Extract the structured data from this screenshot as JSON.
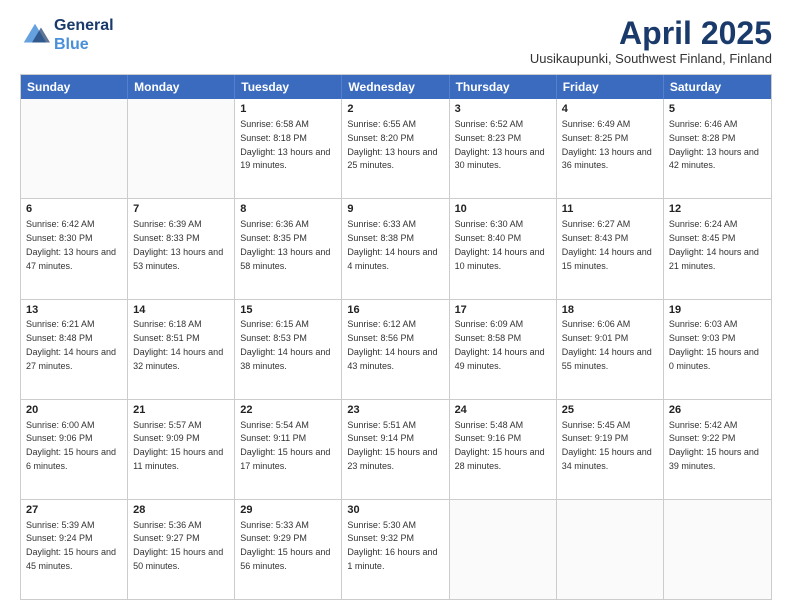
{
  "header": {
    "logo_line1": "General",
    "logo_line2": "Blue",
    "month_title": "April 2025",
    "location": "Uusikaupunki, Southwest Finland, Finland"
  },
  "days_of_week": [
    "Sunday",
    "Monday",
    "Tuesday",
    "Wednesday",
    "Thursday",
    "Friday",
    "Saturday"
  ],
  "weeks": [
    [
      {
        "day": "",
        "empty": true
      },
      {
        "day": "",
        "empty": true
      },
      {
        "day": "1",
        "sunrise": "Sunrise: 6:58 AM",
        "sunset": "Sunset: 8:18 PM",
        "daylight": "Daylight: 13 hours and 19 minutes."
      },
      {
        "day": "2",
        "sunrise": "Sunrise: 6:55 AM",
        "sunset": "Sunset: 8:20 PM",
        "daylight": "Daylight: 13 hours and 25 minutes."
      },
      {
        "day": "3",
        "sunrise": "Sunrise: 6:52 AM",
        "sunset": "Sunset: 8:23 PM",
        "daylight": "Daylight: 13 hours and 30 minutes."
      },
      {
        "day": "4",
        "sunrise": "Sunrise: 6:49 AM",
        "sunset": "Sunset: 8:25 PM",
        "daylight": "Daylight: 13 hours and 36 minutes."
      },
      {
        "day": "5",
        "sunrise": "Sunrise: 6:46 AM",
        "sunset": "Sunset: 8:28 PM",
        "daylight": "Daylight: 13 hours and 42 minutes."
      }
    ],
    [
      {
        "day": "6",
        "sunrise": "Sunrise: 6:42 AM",
        "sunset": "Sunset: 8:30 PM",
        "daylight": "Daylight: 13 hours and 47 minutes."
      },
      {
        "day": "7",
        "sunrise": "Sunrise: 6:39 AM",
        "sunset": "Sunset: 8:33 PM",
        "daylight": "Daylight: 13 hours and 53 minutes."
      },
      {
        "day": "8",
        "sunrise": "Sunrise: 6:36 AM",
        "sunset": "Sunset: 8:35 PM",
        "daylight": "Daylight: 13 hours and 58 minutes."
      },
      {
        "day": "9",
        "sunrise": "Sunrise: 6:33 AM",
        "sunset": "Sunset: 8:38 PM",
        "daylight": "Daylight: 14 hours and 4 minutes."
      },
      {
        "day": "10",
        "sunrise": "Sunrise: 6:30 AM",
        "sunset": "Sunset: 8:40 PM",
        "daylight": "Daylight: 14 hours and 10 minutes."
      },
      {
        "day": "11",
        "sunrise": "Sunrise: 6:27 AM",
        "sunset": "Sunset: 8:43 PM",
        "daylight": "Daylight: 14 hours and 15 minutes."
      },
      {
        "day": "12",
        "sunrise": "Sunrise: 6:24 AM",
        "sunset": "Sunset: 8:45 PM",
        "daylight": "Daylight: 14 hours and 21 minutes."
      }
    ],
    [
      {
        "day": "13",
        "sunrise": "Sunrise: 6:21 AM",
        "sunset": "Sunset: 8:48 PM",
        "daylight": "Daylight: 14 hours and 27 minutes."
      },
      {
        "day": "14",
        "sunrise": "Sunrise: 6:18 AM",
        "sunset": "Sunset: 8:51 PM",
        "daylight": "Daylight: 14 hours and 32 minutes."
      },
      {
        "day": "15",
        "sunrise": "Sunrise: 6:15 AM",
        "sunset": "Sunset: 8:53 PM",
        "daylight": "Daylight: 14 hours and 38 minutes."
      },
      {
        "day": "16",
        "sunrise": "Sunrise: 6:12 AM",
        "sunset": "Sunset: 8:56 PM",
        "daylight": "Daylight: 14 hours and 43 minutes."
      },
      {
        "day": "17",
        "sunrise": "Sunrise: 6:09 AM",
        "sunset": "Sunset: 8:58 PM",
        "daylight": "Daylight: 14 hours and 49 minutes."
      },
      {
        "day": "18",
        "sunrise": "Sunrise: 6:06 AM",
        "sunset": "Sunset: 9:01 PM",
        "daylight": "Daylight: 14 hours and 55 minutes."
      },
      {
        "day": "19",
        "sunrise": "Sunrise: 6:03 AM",
        "sunset": "Sunset: 9:03 PM",
        "daylight": "Daylight: 15 hours and 0 minutes."
      }
    ],
    [
      {
        "day": "20",
        "sunrise": "Sunrise: 6:00 AM",
        "sunset": "Sunset: 9:06 PM",
        "daylight": "Daylight: 15 hours and 6 minutes."
      },
      {
        "day": "21",
        "sunrise": "Sunrise: 5:57 AM",
        "sunset": "Sunset: 9:09 PM",
        "daylight": "Daylight: 15 hours and 11 minutes."
      },
      {
        "day": "22",
        "sunrise": "Sunrise: 5:54 AM",
        "sunset": "Sunset: 9:11 PM",
        "daylight": "Daylight: 15 hours and 17 minutes."
      },
      {
        "day": "23",
        "sunrise": "Sunrise: 5:51 AM",
        "sunset": "Sunset: 9:14 PM",
        "daylight": "Daylight: 15 hours and 23 minutes."
      },
      {
        "day": "24",
        "sunrise": "Sunrise: 5:48 AM",
        "sunset": "Sunset: 9:16 PM",
        "daylight": "Daylight: 15 hours and 28 minutes."
      },
      {
        "day": "25",
        "sunrise": "Sunrise: 5:45 AM",
        "sunset": "Sunset: 9:19 PM",
        "daylight": "Daylight: 15 hours and 34 minutes."
      },
      {
        "day": "26",
        "sunrise": "Sunrise: 5:42 AM",
        "sunset": "Sunset: 9:22 PM",
        "daylight": "Daylight: 15 hours and 39 minutes."
      }
    ],
    [
      {
        "day": "27",
        "sunrise": "Sunrise: 5:39 AM",
        "sunset": "Sunset: 9:24 PM",
        "daylight": "Daylight: 15 hours and 45 minutes."
      },
      {
        "day": "28",
        "sunrise": "Sunrise: 5:36 AM",
        "sunset": "Sunset: 9:27 PM",
        "daylight": "Daylight: 15 hours and 50 minutes."
      },
      {
        "day": "29",
        "sunrise": "Sunrise: 5:33 AM",
        "sunset": "Sunset: 9:29 PM",
        "daylight": "Daylight: 15 hours and 56 minutes."
      },
      {
        "day": "30",
        "sunrise": "Sunrise: 5:30 AM",
        "sunset": "Sunset: 9:32 PM",
        "daylight": "Daylight: 16 hours and 1 minute."
      },
      {
        "day": "",
        "empty": true
      },
      {
        "day": "",
        "empty": true
      },
      {
        "day": "",
        "empty": true
      }
    ]
  ]
}
